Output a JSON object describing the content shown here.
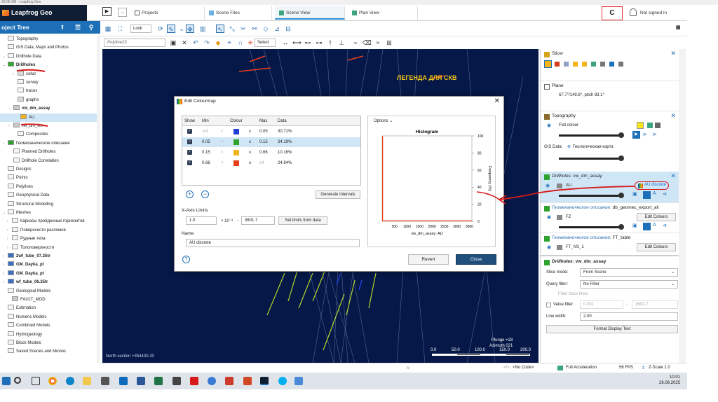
{
  "window": {
    "title": "26:06 SM - Leapfrog Geo"
  },
  "app": {
    "name": "Leapfrog Geo"
  },
  "tabs": [
    {
      "label": "Projects"
    },
    {
      "label": "Scene Files"
    },
    {
      "label": "Scene View"
    },
    {
      "label": "Plan View"
    }
  ],
  "account": {
    "label": "Not signed in"
  },
  "project_tree": {
    "title": "oject Tree",
    "items": [
      {
        "label": "Topography"
      },
      {
        "label": "GIS Data, Maps and Photos"
      },
      {
        "label": "Drillhole Data"
      },
      {
        "label": "Drillholes"
      },
      {
        "label": "collar"
      },
      {
        "label": "survey"
      },
      {
        "label": "traces"
      },
      {
        "label": "graphs"
      },
      {
        "label": "vw_dm_assay"
      },
      {
        "label": "AU"
      },
      {
        "label": "vw_dm_lith"
      },
      {
        "label": "Composites"
      },
      {
        "label": "Геомеханическое описание"
      },
      {
        "label": "Planned Drillholes"
      },
      {
        "label": "Drillhole Correlation"
      },
      {
        "label": "Designs"
      },
      {
        "label": "Points"
      },
      {
        "label": "Polylines"
      },
      {
        "label": "Geophysical Data"
      },
      {
        "label": "Structural Modelling"
      },
      {
        "label": "Meshes"
      },
      {
        "label": "Каркасы пройденных горизонтов"
      },
      {
        "label": "Поверхности разломов"
      },
      {
        "label": "Рудные тела"
      },
      {
        "label": "Топоповерхности"
      },
      {
        "label": "2wf_tube_07.25tr"
      },
      {
        "label": "GM_Dayka_pt"
      },
      {
        "label": "GM_Dayka_pt"
      },
      {
        "label": "wf_tube_06.25tr"
      },
      {
        "label": "Geological Models"
      },
      {
        "label": "FAULT_MOD"
      },
      {
        "label": "Estimation"
      },
      {
        "label": "Numeric Models"
      },
      {
        "label": "Combined Models"
      },
      {
        "label": "Hydrogeology"
      },
      {
        "label": "Block Models"
      },
      {
        "label": "Saved Scenes and Movies"
      }
    ]
  },
  "toolbar": {
    "look_label": "Look",
    "polyline_placeholder": "Polyline23",
    "select_label": "Select"
  },
  "scene": {
    "legend_title": "ЛЕГЕНДА ДЛЯ СКВ",
    "north_section": "North section +354430.20",
    "plunge": "Plunge +28",
    "azimuth": "Azimuth 021",
    "scale_labels": [
      "0.0",
      "50.0",
      "100.0",
      "150.0",
      "200.0"
    ]
  },
  "right_panel": {
    "slicer_label": "Slicer",
    "plane_label": "Plane",
    "plane_value": "67.7°/149.8°, pitch 83.1°",
    "topography_label": "Topography",
    "flat_colour_label": "Flat colour",
    "gis_data_label": "GIS Data:",
    "gis_data_value": "Геологическая карта",
    "drillholes_label": "Drillholes",
    "drillholes_suffix": ": vw_dm_assay",
    "au_label": "AU",
    "au_discrete_label": "AU discrete",
    "geomech1_prefix": "Геомеханическое описание",
    "geomech1_suffix": ": db_geomec_export_all",
    "fz_label": "FZ",
    "edit_colours_label": "Edit Colours",
    "geomech2_prefix": "Геомеханическое описание",
    "geomech2_suffix": ": FT_table",
    "ftns_label": "FT_NS_1",
    "props_title": "Drillholes",
    "props_title_suffix": ": vw_dm_assay",
    "slice_mode_label": "Slice mode:",
    "slice_mode_value": "From Scene",
    "query_filter_label": "Query filter:",
    "query_filter_value": "No Filter",
    "filter_traces_label": "Filter trace lines",
    "value_filter_label": "Value filter:",
    "value_filter_min": "0.001",
    "value_filter_max": "3601.7",
    "line_width_label": "Line width:",
    "line_width_value": "2.00",
    "format_button": "Format Display Text"
  },
  "dialog": {
    "title": "Edit Colourmap",
    "columns": [
      "Show",
      "Min",
      "",
      "Colour",
      "",
      "Max",
      "Data"
    ],
    "rows": [
      {
        "min": "-inf",
        "op1": "<",
        "color": "#1f3fd6",
        "op2": "≤",
        "max": "0.05",
        "data": "30.71%",
        "muted_min": true,
        "muted_max": false
      },
      {
        "min": "0.05",
        "op1": "<",
        "color": "#2ea32e",
        "op2": "≤",
        "max": "0.15",
        "data": "34.19%",
        "muted_min": false,
        "muted_max": false
      },
      {
        "min": "0.15",
        "op1": "<",
        "color": "#f2b31b",
        "op2": "≤",
        "max": "0.66",
        "data": "10.16%",
        "muted_min": false,
        "muted_max": false
      },
      {
        "min": "0.66",
        "op1": "<",
        "color": "#e8401c",
        "op2": "≤",
        "max": "inf",
        "data": "24.94%",
        "muted_min": false,
        "muted_max": true
      }
    ],
    "generate_intervals": "Generate Intervals",
    "x_axis_limits_label": "X-Axis Limits",
    "x_min": "1.0",
    "x_mult": "× 10⁻³",
    "x_dash": "-",
    "x_max": "3601.7",
    "set_limits_label": "Set limits from data",
    "name_label": "Name",
    "name_value": "AU discrete",
    "options_label": "Options",
    "revert_label": "Revert",
    "close_label": "Close"
  },
  "chart_data": {
    "type": "bar",
    "title": "Histogram",
    "xlabel": "vw_dm_assay: AU",
    "ylabel": "Frequency (%)",
    "x_ticks": [
      "500",
      "1000",
      "1500",
      "2000",
      "2500",
      "3000",
      "3500"
    ],
    "y_ticks": [
      "0",
      "20",
      "40",
      "60",
      "80",
      "100"
    ],
    "xlim": [
      0,
      3601.7
    ],
    "ylim": [
      0,
      100
    ],
    "bins": [
      {
        "x0": 0,
        "x1": 36,
        "value": 100,
        "color": "#e8401c"
      },
      {
        "x0": 36,
        "x1": 3601.7,
        "value": 1,
        "color": "#e8401c"
      }
    ]
  },
  "status": {
    "no_code": "<No Code>",
    "acceleration": "Full Acceleration",
    "fps": "56 FPS",
    "zscale": "Z-Scale 1.0"
  },
  "clock": {
    "time": "10:01",
    "date": "26.08.2025"
  },
  "colors": {
    "brand_dark": "#0f1e33",
    "accent": "#1d6fb8",
    "scene_bg": "#061848",
    "annotation_red": "#d61a1a"
  }
}
